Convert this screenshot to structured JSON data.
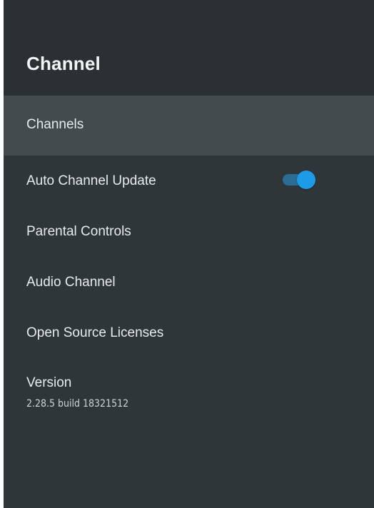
{
  "header": {
    "title": "Channel"
  },
  "menu": {
    "items": [
      {
        "label": "Channels"
      },
      {
        "label": "Auto Channel Update",
        "toggle_on": true
      },
      {
        "label": "Parental Controls"
      },
      {
        "label": "Audio Channel"
      },
      {
        "label": "Open Source Licenses"
      },
      {
        "label": "Version",
        "sub": "2.28.5 build 18321512"
      }
    ]
  },
  "colors": {
    "panel_bg": "#2f3639",
    "header_bg": "#2a3033",
    "focused_bg": "#434b4e",
    "toggle_accent": "#1e9be6"
  }
}
